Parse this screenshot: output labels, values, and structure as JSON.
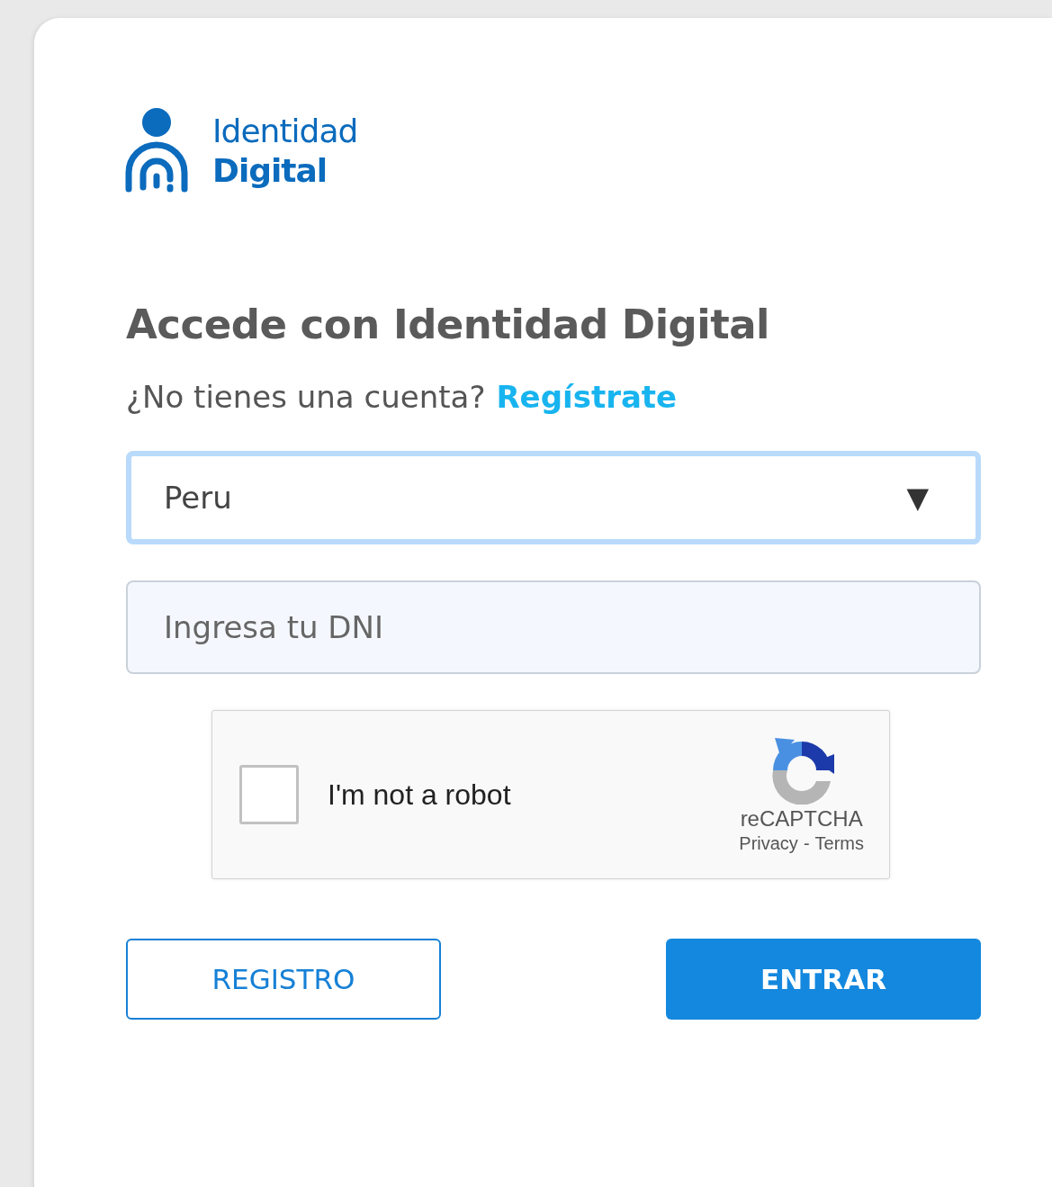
{
  "logo": {
    "line_1": "Identidad",
    "line_2": "Digital"
  },
  "title": "Accede con Identidad Digital",
  "signup": {
    "prompt": "¿No tienes una cuenta?",
    "link": "Regístrate"
  },
  "country_select": {
    "value": "Peru",
    "caret": "▼",
    "focused": true
  },
  "dni_field": {
    "placeholder": "Ingresa tu DNI"
  },
  "captcha": {
    "label": "I'm not a robot",
    "checked": false,
    "brand": "reCAPTCHA",
    "privacy": "Privacy",
    "separator": "-",
    "terms": "Terms"
  },
  "buttons": [
    {
      "label": "REGISTRO",
      "kind": "outline"
    },
    {
      "label": "ENTRAR",
      "kind": "primary"
    }
  ]
}
